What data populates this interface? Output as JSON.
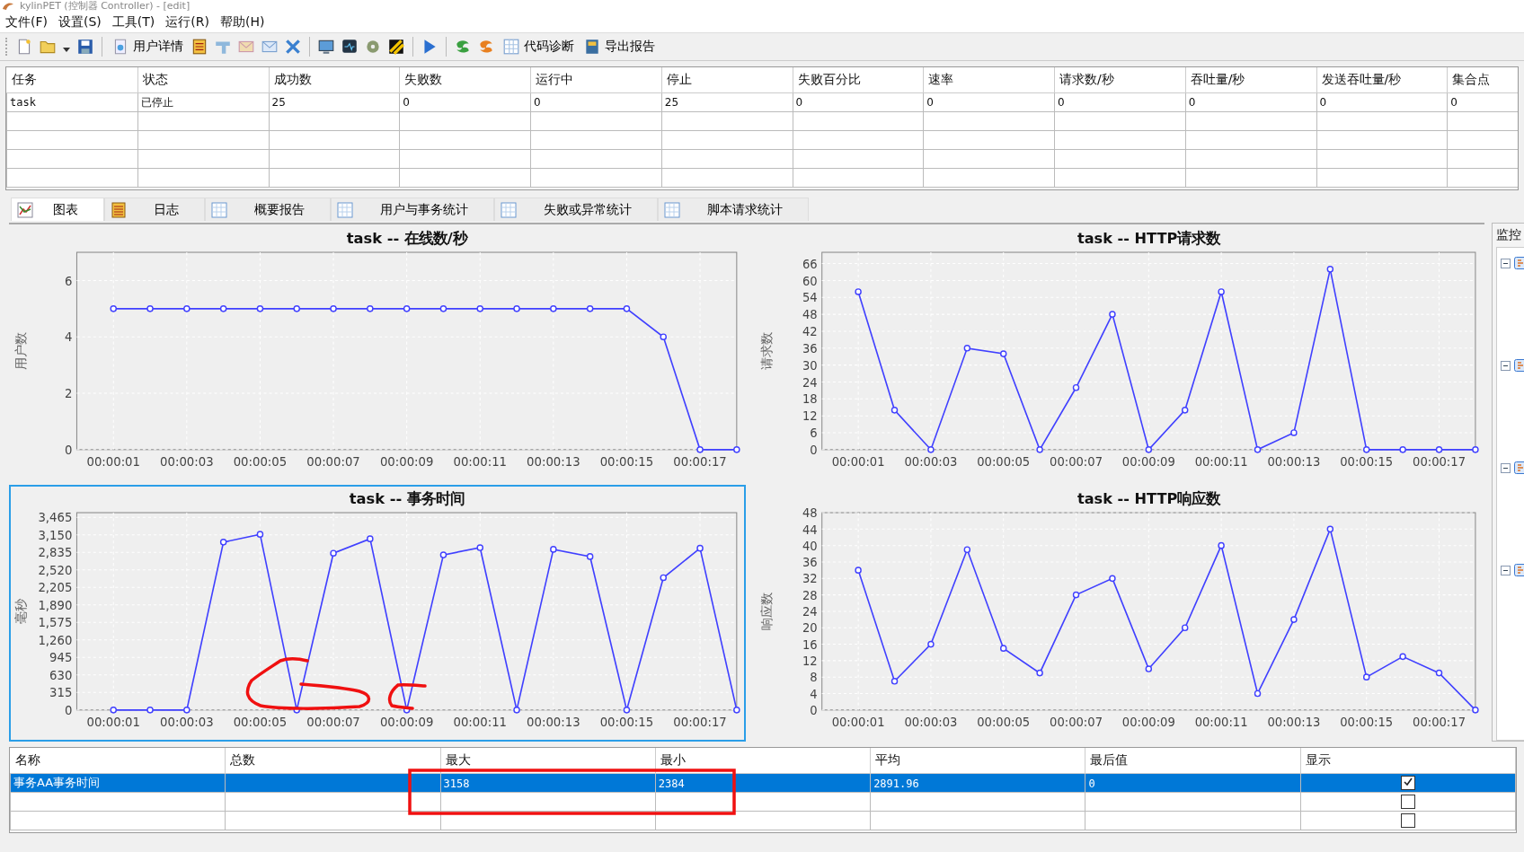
{
  "window": {
    "title": "kylinPET (控制器 Controller) - [edit]"
  },
  "menu": [
    "文件(F)",
    "设置(S)",
    "工具(T)",
    "运行(R)",
    "帮助(H)"
  ],
  "toolbar": [
    {
      "label": "用户详情"
    },
    {
      "label": "代码诊断"
    },
    {
      "label": "导出报告"
    }
  ],
  "task_table": {
    "columns": [
      "任务",
      "状态",
      "成功数",
      "失败数",
      "运行中",
      "停止",
      "失败百分比",
      "速率",
      "请求数/秒",
      "吞吐量/秒",
      "发送吞吐量/秒",
      "集合点"
    ],
    "rows": [
      [
        "task",
        "已停止",
        "25",
        "0",
        "0",
        "25",
        "0",
        "0",
        "0",
        "0",
        "0",
        "0"
      ]
    ]
  },
  "tabs": [
    {
      "label": "图表",
      "kind": "chart",
      "selected": true
    },
    {
      "label": "日志",
      "kind": "log",
      "selected": false
    },
    {
      "label": "概要报告",
      "kind": "table",
      "selected": false
    },
    {
      "label": "用户与事务统计",
      "kind": "table",
      "selected": false
    },
    {
      "label": "失败或异常统计",
      "kind": "table",
      "selected": false
    },
    {
      "label": "脚本请求统计",
      "kind": "table",
      "selected": false
    }
  ],
  "charts": [
    {
      "selected": false,
      "chart_data": {
        "type": "line",
        "title": "task -- 在线数/秒",
        "ylabel": "用户数",
        "x": [
          1,
          2,
          3,
          4,
          5,
          6,
          7,
          8,
          9,
          10,
          11,
          12,
          13,
          14,
          15,
          16,
          17,
          18
        ],
        "grid": true,
        "series": [
          {
            "marker": "circle",
            "color": "#4040ff",
            "values": [
              5,
              5,
              5,
              5,
              5,
              5,
              5,
              5,
              5,
              5,
              5,
              5,
              5,
              5,
              5,
              4,
              0,
              0
            ]
          }
        ],
        "xlim": [
          0,
          18
        ],
        "ylim": [
          0,
          7
        ],
        "xticks": [
          {
            "value": 1,
            "label": "00:00:01"
          },
          {
            "value": 3,
            "label": "00:00:03"
          },
          {
            "value": 5,
            "label": "00:00:05"
          },
          {
            "value": 7,
            "label": "00:00:07"
          },
          {
            "value": 9,
            "label": "00:00:09"
          },
          {
            "value": 11,
            "label": "00:00:11"
          },
          {
            "value": 13,
            "label": "00:00:13"
          },
          {
            "value": 15,
            "label": "00:00:15"
          },
          {
            "value": 17,
            "label": "00:00:17"
          }
        ],
        "yticks": [
          0,
          2,
          4,
          6
        ]
      }
    },
    {
      "selected": false,
      "chart_data": {
        "type": "line",
        "title": "task -- HTTP请求数",
        "ylabel": "请求数",
        "x": [
          1,
          2,
          3,
          4,
          5,
          6,
          7,
          8,
          9,
          10,
          11,
          12,
          13,
          14,
          15,
          16,
          17,
          18
        ],
        "grid": true,
        "series": [
          {
            "marker": "circle",
            "color": "#4040ff",
            "values": [
              56,
              14,
              0,
              36,
              34,
              0,
              22,
              48,
              0,
              14,
              56,
              0,
              6,
              64,
              0,
              0,
              0,
              0
            ]
          }
        ],
        "xlim": [
          0,
          18
        ],
        "ylim": [
          0,
          70
        ],
        "xticks": [
          {
            "value": 1,
            "label": "00:00:01"
          },
          {
            "value": 3,
            "label": "00:00:03"
          },
          {
            "value": 5,
            "label": "00:00:05"
          },
          {
            "value": 7,
            "label": "00:00:07"
          },
          {
            "value": 9,
            "label": "00:00:09"
          },
          {
            "value": 11,
            "label": "00:00:11"
          },
          {
            "value": 13,
            "label": "00:00:13"
          },
          {
            "value": 15,
            "label": "00:00:15"
          },
          {
            "value": 17,
            "label": "00:00:17"
          }
        ],
        "yticks": [
          0,
          6,
          12,
          18,
          24,
          30,
          36,
          42,
          48,
          54,
          60,
          66
        ]
      }
    },
    {
      "selected": true,
      "chart_data": {
        "type": "line",
        "title": "task -- 事务时间",
        "ylabel": "毫秒",
        "x": [
          1,
          2,
          3,
          4,
          5,
          6,
          7,
          8,
          9,
          10,
          11,
          12,
          13,
          14,
          15,
          16,
          17,
          18
        ],
        "grid": true,
        "series": [
          {
            "marker": "circle",
            "color": "#4040ff",
            "values": [
              0,
              0,
              0,
              3020,
              3160,
              0,
              2820,
              3080,
              0,
              2790,
              2920,
              0,
              2890,
              2760,
              0,
              2380,
              2910,
              0
            ]
          }
        ],
        "xlim": [
          0,
          18
        ],
        "ylim": [
          0,
          3550
        ],
        "xticks": [
          {
            "value": 1,
            "label": "00:00:01"
          },
          {
            "value": 3,
            "label": "00:00:03"
          },
          {
            "value": 5,
            "label": "00:00:05"
          },
          {
            "value": 7,
            "label": "00:00:07"
          },
          {
            "value": 9,
            "label": "00:00:09"
          },
          {
            "value": 11,
            "label": "00:00:11"
          },
          {
            "value": 13,
            "label": "00:00:13"
          },
          {
            "value": 15,
            "label": "00:00:15"
          },
          {
            "value": 17,
            "label": "00:00:17"
          }
        ],
        "yticks": [
          0,
          315,
          630,
          945,
          {
            "value": 1260,
            "label": "1,260"
          },
          {
            "value": 1575,
            "label": "1,575"
          },
          {
            "value": 1890,
            "label": "1,890"
          },
          {
            "value": 2205,
            "label": "2,205"
          },
          {
            "value": 2520,
            "label": "2,520"
          },
          {
            "value": 2835,
            "label": "2,835"
          },
          {
            "value": 3150,
            "label": "3,150"
          },
          {
            "value": 3465,
            "label": "3,465"
          }
        ]
      }
    },
    {
      "selected": false,
      "chart_data": {
        "type": "line",
        "title": "task -- HTTP响应数",
        "ylabel": "响应数",
        "x": [
          1,
          2,
          3,
          4,
          5,
          6,
          7,
          8,
          9,
          10,
          11,
          12,
          13,
          14,
          15,
          16,
          17,
          18
        ],
        "grid": true,
        "series": [
          {
            "marker": "circle",
            "color": "#4040ff",
            "values": [
              34,
              7,
              16,
              39,
              15,
              9,
              28,
              32,
              10,
              20,
              40,
              4,
              22,
              44,
              8,
              13,
              9,
              0
            ]
          }
        ],
        "xlim": [
          0,
          18
        ],
        "ylim": [
          0,
          48
        ],
        "xticks": [
          {
            "value": 1,
            "label": "00:00:01"
          },
          {
            "value": 3,
            "label": "00:00:03"
          },
          {
            "value": 5,
            "label": "00:00:05"
          },
          {
            "value": 7,
            "label": "00:00:07"
          },
          {
            "value": 9,
            "label": "00:00:09"
          },
          {
            "value": 11,
            "label": "00:00:11"
          },
          {
            "value": 13,
            "label": "00:00:13"
          },
          {
            "value": 15,
            "label": "00:00:15"
          },
          {
            "value": 17,
            "label": "00:00:17"
          }
        ],
        "yticks": [
          0,
          4,
          8,
          12,
          16,
          20,
          24,
          28,
          32,
          36,
          40,
          44,
          48
        ]
      }
    }
  ],
  "monitor_panel": {
    "title": "监控",
    "nodes": [
      {
        "expanded": true
      },
      {
        "expanded": true
      },
      {
        "expanded": true
      },
      {
        "expanded": true
      }
    ]
  },
  "stats_table": {
    "columns": [
      "名称",
      "总数",
      "最大",
      "最小",
      "平均",
      "最后值",
      "显示"
    ],
    "rows": [
      {
        "name": "事务AA事务时间",
        "max": "3158",
        "min": "2384",
        "avg": "2891.96",
        "last": "0",
        "selected": true,
        "checked": true
      },
      {
        "selected": false,
        "checked": false
      },
      {
        "selected": false,
        "checked": false
      }
    ]
  },
  "annotations": [
    {
      "kind": "loop"
    },
    {
      "kind": "hook"
    },
    {
      "kind": "box"
    }
  ]
}
